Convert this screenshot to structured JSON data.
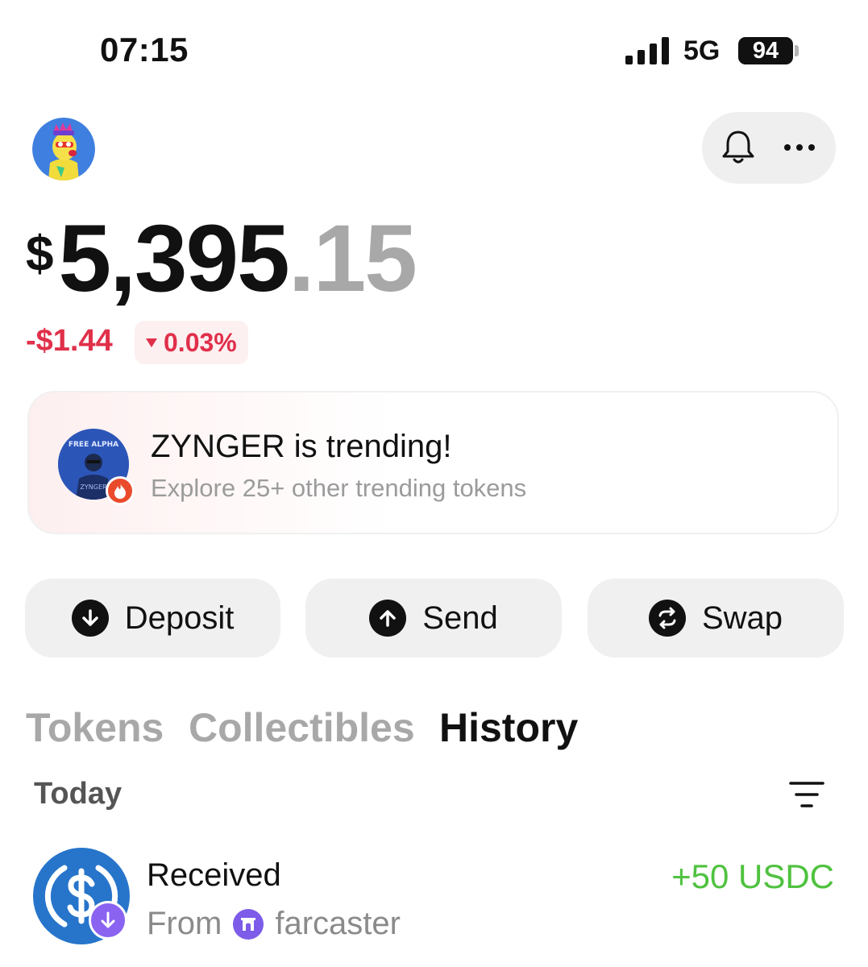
{
  "status_bar": {
    "time": "07:15",
    "network": "5G",
    "battery": "94"
  },
  "header": {
    "avatar": "profile-avatar",
    "bell_icon": "bell-icon",
    "more_icon": "more-icon"
  },
  "balance": {
    "currency": "$",
    "integer": "5,395",
    "decimal": ".15"
  },
  "change": {
    "amount": "-$1.44",
    "percent": "0.03%",
    "direction": "down"
  },
  "trending": {
    "title": "ZYNGER is trending!",
    "subtitle": "Explore 25+ other trending tokens",
    "logo_text": "FREE ALPHA",
    "logo_sub": "ZYNGER"
  },
  "actions": {
    "deposit": "Deposit",
    "send": "Send",
    "swap": "Swap"
  },
  "tabs": {
    "tokens": "Tokens",
    "collectibles": "Collectibles",
    "history": "History",
    "active": "History"
  },
  "history": {
    "section": "Today",
    "items": [
      {
        "title": "Received",
        "from_prefix": "From",
        "from_name": "farcaster",
        "amount": "+50 USDC",
        "token_icon": "usdc-icon"
      }
    ]
  },
  "colors": {
    "negative": "#e0304a",
    "positive": "#4fc23f",
    "usdc_blue": "#2775ca",
    "farcaster_purple": "#7c5ce8"
  }
}
